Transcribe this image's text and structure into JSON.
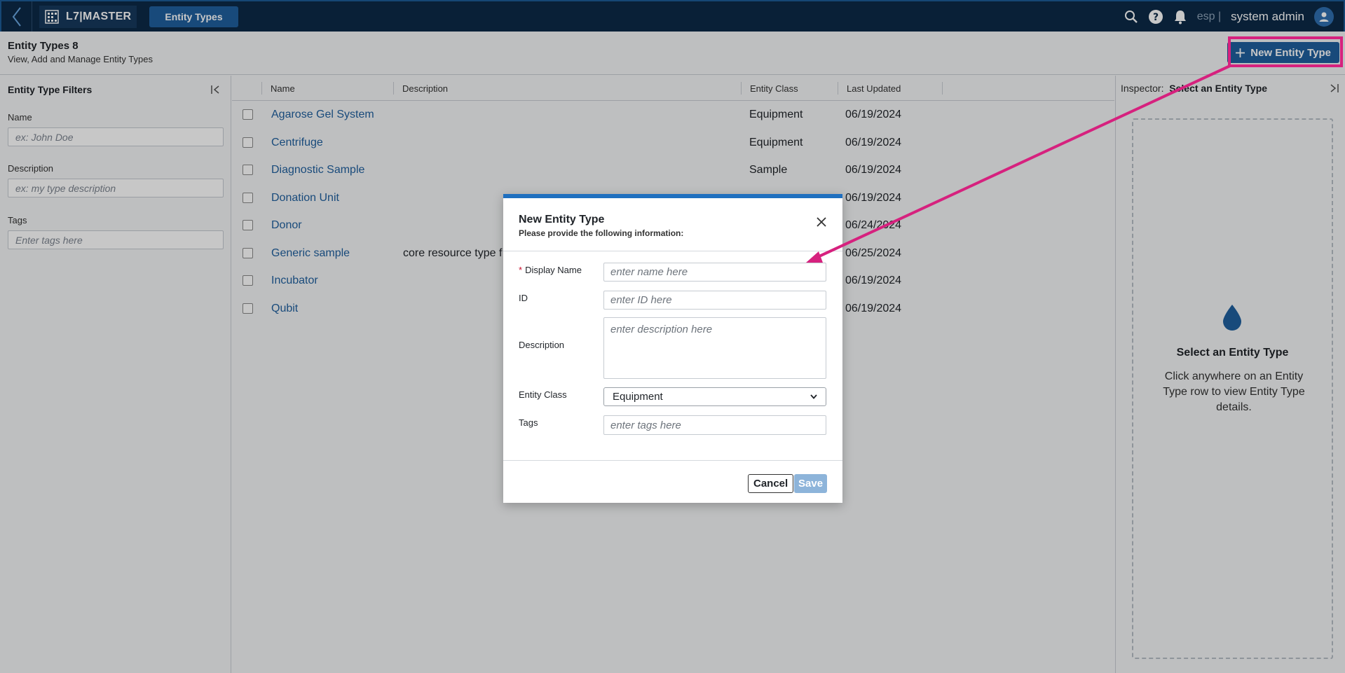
{
  "topbar": {
    "logo_text": "L7|MASTER",
    "active_nav": "Entity Types",
    "lang": "esp |",
    "user_name": "system admin"
  },
  "header": {
    "title": "Entity Types 8",
    "subtitle": "View, Add and Manage Entity Types",
    "new_button_label": "New Entity Type"
  },
  "filters": {
    "title": "Entity Type Filters",
    "name_label": "Name",
    "name_placeholder": "ex: John Doe",
    "description_label": "Description",
    "description_placeholder": "ex: my type description",
    "tags_label": "Tags",
    "tags_placeholder": "Enter tags here"
  },
  "table": {
    "columns": [
      "Name",
      "Description",
      "Entity Class",
      "Last Updated"
    ],
    "rows": [
      {
        "name": "Agarose Gel System",
        "description": "",
        "entity_class": "Equipment",
        "last_updated": "06/19/2024"
      },
      {
        "name": "Centrifuge",
        "description": "",
        "entity_class": "Equipment",
        "last_updated": "06/19/2024"
      },
      {
        "name": "Diagnostic Sample",
        "description": "",
        "entity_class": "Sample",
        "last_updated": "06/19/2024"
      },
      {
        "name": "Donation Unit",
        "description": "",
        "entity_class": "",
        "last_updated": "06/19/2024"
      },
      {
        "name": "Donor",
        "description": "",
        "entity_class": "",
        "last_updated": "06/24/2024"
      },
      {
        "name": "Generic sample",
        "description": "core resource type f",
        "entity_class": "",
        "last_updated": "06/25/2024"
      },
      {
        "name": "Incubator",
        "description": "",
        "entity_class": "",
        "last_updated": "06/19/2024"
      },
      {
        "name": "Qubit",
        "description": "",
        "entity_class": "",
        "last_updated": "06/19/2024"
      }
    ]
  },
  "inspector": {
    "label": "Inspector:",
    "selection": "Select an Entity Type",
    "empty_title": "Select an Entity Type",
    "empty_text": "Click anywhere on an Entity Type row to view Entity Type details."
  },
  "modal": {
    "title": "New Entity Type",
    "subtitle": "Please provide the following information:",
    "display_name_label": "Display Name",
    "display_name_placeholder": "enter name here",
    "id_label": "ID",
    "id_placeholder": "enter ID here",
    "description_label": "Description",
    "description_placeholder": "enter description here",
    "entity_class_label": "Entity Class",
    "entity_class_value": "Equipment",
    "tags_label": "Tags",
    "tags_placeholder": "enter tags here",
    "cancel_label": "Cancel",
    "save_label": "Save"
  },
  "colors": {
    "navbar": "#0c2a47",
    "accent": "#1f5f9e",
    "annotation": "#d6217e",
    "link": "#1f5f9e"
  }
}
